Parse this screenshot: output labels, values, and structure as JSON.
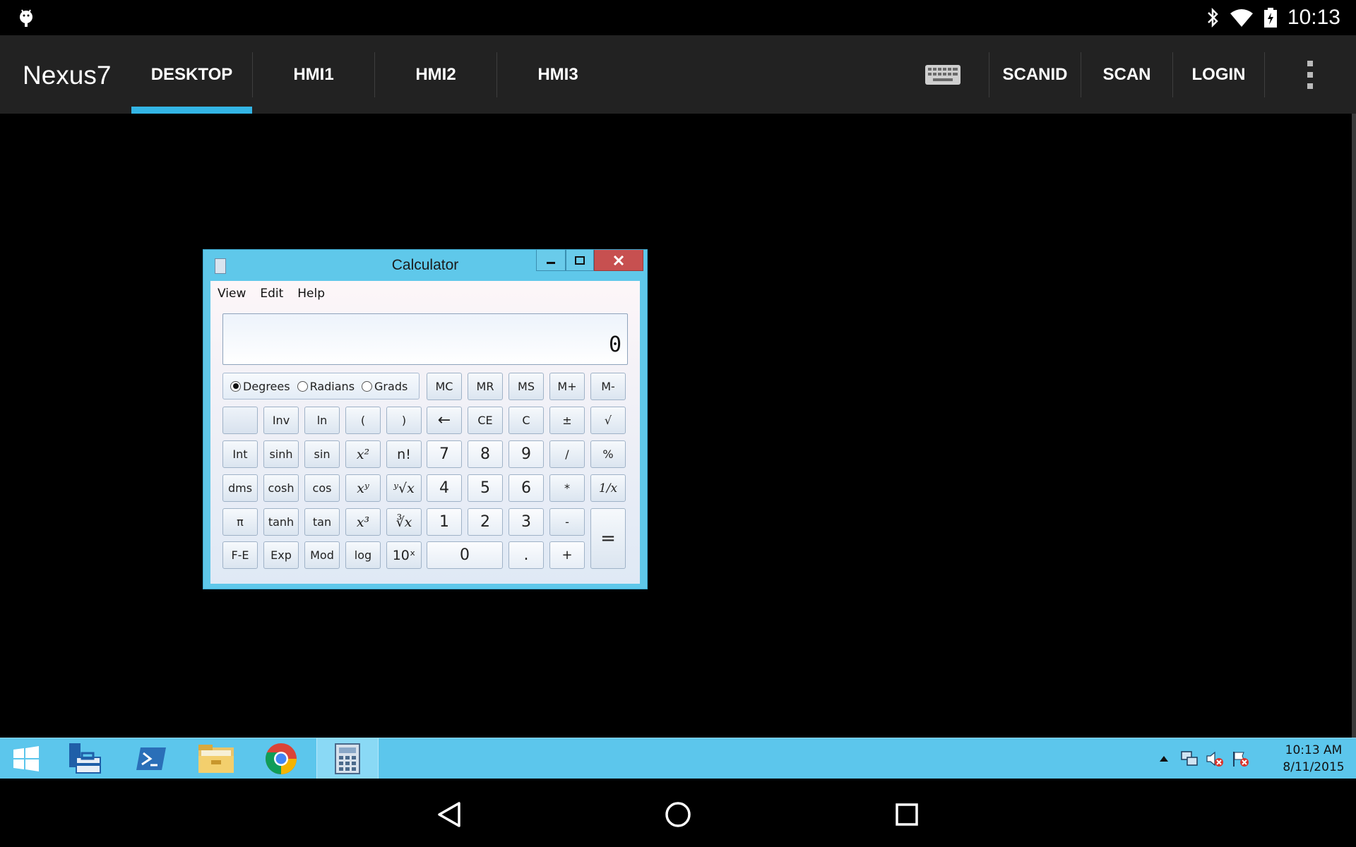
{
  "status_bar": {
    "time": "10:13",
    "icons": [
      "android-debug-icon",
      "bluetooth-icon",
      "wifi-icon",
      "battery-charging-icon"
    ]
  },
  "action_bar": {
    "app_title": "Nexus7",
    "tabs": [
      {
        "label": "DESKTOP",
        "active": true
      },
      {
        "label": "HMI1",
        "active": false
      },
      {
        "label": "HMI2",
        "active": false
      },
      {
        "label": "HMI3",
        "active": false
      }
    ],
    "actions": {
      "keyboard_icon": "keyboard-icon",
      "scanid": "SCANID",
      "scan": "SCAN",
      "login": "LOGIN",
      "overflow_icon": "overflow-menu-icon"
    },
    "accent_color": "#33b5e5"
  },
  "calculator": {
    "title": "Calculator",
    "menu": [
      "View",
      "Edit",
      "Help"
    ],
    "display": "0",
    "angle_modes": [
      {
        "label": "Degrees",
        "selected": true
      },
      {
        "label": "Radians",
        "selected": false
      },
      {
        "label": "Grads",
        "selected": false
      }
    ],
    "memory_keys": [
      "MC",
      "MR",
      "MS",
      "M+",
      "M-"
    ],
    "rows": [
      [
        "",
        "Inv",
        "ln",
        "(",
        ")",
        "←",
        "CE",
        "C",
        "±",
        "√"
      ],
      [
        "Int",
        "sinh",
        "sin",
        "x²",
        "n!",
        "7",
        "8",
        "9",
        "/",
        "%"
      ],
      [
        "dms",
        "cosh",
        "cos",
        "xʸ",
        "ʸ√x",
        "4",
        "5",
        "6",
        "*",
        "1/x"
      ],
      [
        "π",
        "tanh",
        "tan",
        "x³",
        "∛x",
        "1",
        "2",
        "3",
        "-"
      ],
      [
        "F-E",
        "Exp",
        "Mod",
        "log",
        "10ˣ",
        "0",
        ".",
        "+"
      ]
    ],
    "equals": "="
  },
  "taskbar": {
    "items": [
      "windows-start-icon",
      "server-manager-icon",
      "powershell-icon",
      "file-explorer-icon",
      "chrome-icon",
      "calculator-icon"
    ],
    "tray_icons": [
      "tray-expand-icon",
      "network-icon",
      "volume-muted-icon",
      "action-center-icon"
    ],
    "clock_time": "10:13 AM",
    "clock_date": "8/11/2015",
    "color": "#5cc6ec"
  },
  "nav_bar": {
    "buttons": [
      "back-icon",
      "home-icon",
      "recents-icon"
    ]
  }
}
